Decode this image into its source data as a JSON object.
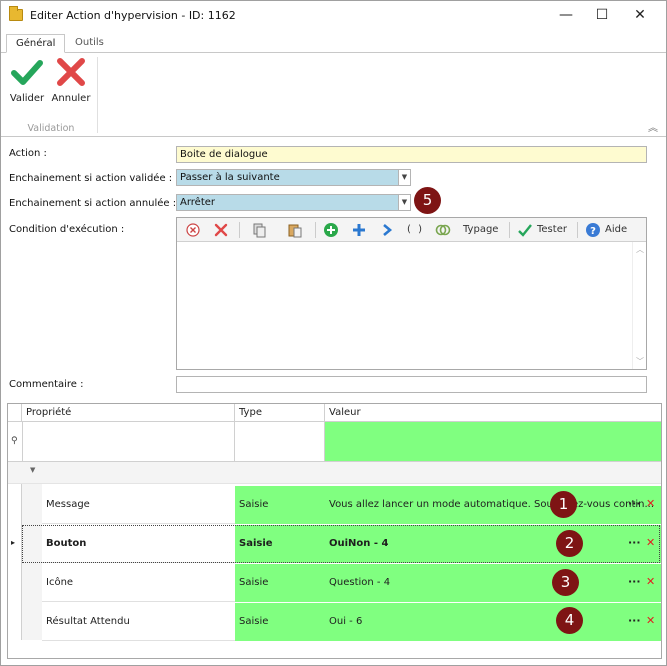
{
  "window": {
    "title": "Editer Action d'hypervision - ID: 1162",
    "minimize": "—",
    "maximize": "☐",
    "close": "✕"
  },
  "tabs": [
    "Général",
    "Outils"
  ],
  "ribbon": {
    "validate_label": "Valider",
    "cancel_label": "Annuler",
    "group_label": "Validation",
    "collapse_glyph": "︽"
  },
  "form": {
    "action_label": "Action :",
    "action_value": "Boite de dialogue",
    "on_valid_label": "Enchainement si action validée :",
    "on_valid_value": "Passer à la suivante",
    "on_cancel_label": "Enchainement si action annulée :",
    "on_cancel_value": "Arrêter",
    "condition_label": "Condition d'exécution :",
    "comment_label": "Commentaire :",
    "comment_value": ""
  },
  "condition_toolbar": {
    "typing_label": "Typage",
    "test_label": "Tester",
    "help_label": "Aide",
    "parens_label": "( )"
  },
  "grid": {
    "columns": [
      "Propriété",
      "Type",
      "Valeur"
    ],
    "rows": [
      {
        "name": "Message",
        "type": "Saisie",
        "value": "Vous allez lancer un mode automatique. Souhaitez-vous contin...",
        "badge": "1"
      },
      {
        "name": "Bouton",
        "type": "Saisie",
        "value": "OuiNon - 4",
        "badge": "2"
      },
      {
        "name": "Icône",
        "type": "Saisie",
        "value": "Question - 4",
        "badge": "3"
      },
      {
        "name": "Résultat Attendu",
        "type": "Saisie",
        "value": "Oui - 6",
        "badge": "4"
      }
    ],
    "more_glyph": "···",
    "delete_glyph": "✕"
  },
  "badge_combo": "5",
  "colors": {
    "accent_green": "#80ff80",
    "badge_red": "#7e1414",
    "combo_blue": "#b8dbe8",
    "input_yellow": "#fefbd0"
  }
}
